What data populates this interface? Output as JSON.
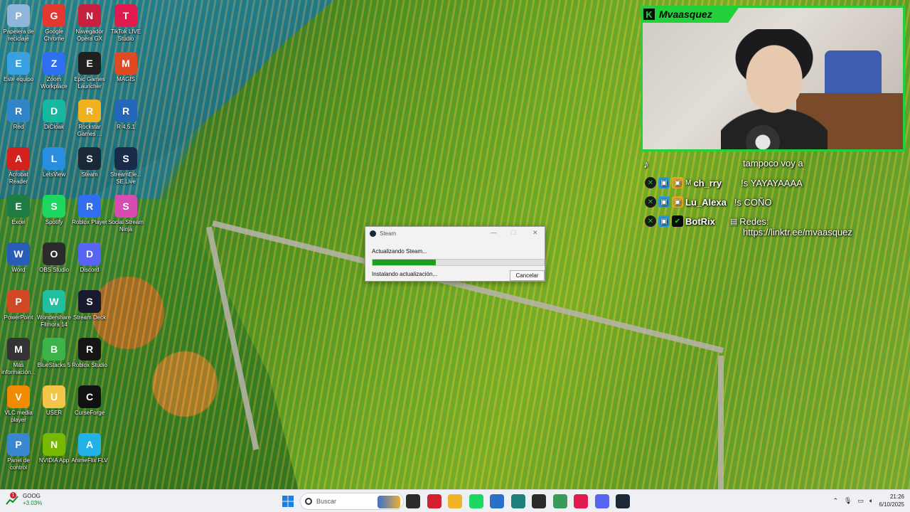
{
  "desktop": {
    "icons": [
      {
        "label": "Papelera de reciclaje",
        "icon": "recycle-bin-icon",
        "color": "#8fb6d9"
      },
      {
        "label": "Google Chrome",
        "icon": "chrome-icon",
        "color": "#e3382f"
      },
      {
        "label": "Navegador Opera GX",
        "icon": "opera-gx-icon",
        "color": "#c8203f"
      },
      {
        "label": "TikTok LIVE Studio",
        "icon": "tiktok-live-icon",
        "color": "#e01a4f"
      },
      {
        "label": "Este equipo",
        "icon": "computer-icon",
        "color": "#3aa0e0"
      },
      {
        "label": "Zoom Workplace",
        "icon": "zoom-icon",
        "color": "#2d6ff0"
      },
      {
        "label": "Epic Games Launcher",
        "icon": "epic-games-icon",
        "color": "#202020"
      },
      {
        "label": "MAGIS",
        "icon": "magis-icon",
        "color": "#e04a22"
      },
      {
        "label": "Red",
        "icon": "network-icon",
        "color": "#2f85c8"
      },
      {
        "label": "DiCloak",
        "icon": "dicloak-icon",
        "color": "#17b8a0"
      },
      {
        "label": "Rockstar Games ...",
        "icon": "rockstar-icon",
        "color": "#f0b020"
      },
      {
        "label": "R 4.5.1",
        "icon": "r-icon",
        "color": "#2466b8"
      },
      {
        "label": "Acrobat Reader",
        "icon": "acrobat-icon",
        "color": "#d3221e"
      },
      {
        "label": "LetsView",
        "icon": "letsview-icon",
        "color": "#2a8ee0"
      },
      {
        "label": "Steam",
        "icon": "steam-icon",
        "color": "#1b2838"
      },
      {
        "label": "StreamEle... SE.Live",
        "icon": "streamelements-icon",
        "color": "#1a2b4a"
      },
      {
        "label": "Excel",
        "icon": "excel-icon",
        "color": "#1d7b44"
      },
      {
        "label": "Spotify",
        "icon": "spotify-icon",
        "color": "#1ed760"
      },
      {
        "label": "Roblox Player",
        "icon": "roblox-player-icon",
        "color": "#2f6ff0"
      },
      {
        "label": "Social Stream Ninja",
        "icon": "social-stream-icon",
        "color": "#d84bb0"
      },
      {
        "label": "Word",
        "icon": "word-icon",
        "color": "#2a5bb5"
      },
      {
        "label": "OBS Studio",
        "icon": "obs-icon",
        "color": "#2b2b2b"
      },
      {
        "label": "Discord",
        "icon": "discord-icon",
        "color": "#5865f2"
      },
      {
        "label": "PowerPoint",
        "icon": "powerpoint-icon",
        "color": "#d24726"
      },
      {
        "label": "Wondershare Filmora 14",
        "icon": "filmora-icon",
        "color": "#1fbf9f"
      },
      {
        "label": "Stream Deck",
        "icon": "stream-deck-icon",
        "color": "#1a1a2e"
      },
      {
        "label": "Más información...",
        "icon": "info-icon",
        "color": "#333333"
      },
      {
        "label": "BlueStacks 5",
        "icon": "bluestacks-icon",
        "color": "#3cb44a"
      },
      {
        "label": "Roblox Studio",
        "icon": "roblox-studio-icon",
        "color": "#151515"
      },
      {
        "label": "VLC media player",
        "icon": "vlc-icon",
        "color": "#f08a00"
      },
      {
        "label": "USER",
        "icon": "folder-icon",
        "color": "#f3c548"
      },
      {
        "label": "CurseForge",
        "icon": "curseforge-icon",
        "color": "#111111"
      },
      {
        "label": "Panel de control",
        "icon": "control-panel-icon",
        "color": "#3a86d0"
      },
      {
        "label": "NVIDIA App",
        "icon": "nvidia-icon",
        "color": "#76b900"
      },
      {
        "label": "AnimeFlix FLV",
        "icon": "animeflix-icon",
        "color": "#22b2e5"
      }
    ]
  },
  "overlay": {
    "streamer_name": "Mvaasquez",
    "accent": "#22d13a",
    "chat": {
      "top_text": "tampoco voy a",
      "messages": [
        {
          "user": "ch_rry",
          "text": "!s YAYAYAAAA"
        },
        {
          "user": "Lu_Alexa",
          "text": "!s COÑO"
        },
        {
          "user": "BotRix",
          "text": "Redes:"
        }
      ],
      "botrix_link": "https://linktr.ee/mvaasquez"
    }
  },
  "steam_dialog": {
    "title": "Steam",
    "status": "Actualizando Steam...",
    "progress_fraction": 0.37,
    "substatus": "Instalando actualización...",
    "cancel_label": "Cancelar",
    "progress_color": "#1ea01e"
  },
  "taskbar": {
    "stock_ticker": "GOOG",
    "stock_change": "+3.03%",
    "notification_count": "1",
    "search_placeholder": "Buscar",
    "pinned": [
      {
        "icon": "file-explorer-small-icon",
        "color": "#2b2b2b"
      },
      {
        "icon": "opera-icon",
        "color": "#d3202f"
      },
      {
        "icon": "folder-icon",
        "color": "#f0b429"
      },
      {
        "icon": "spotify-icon",
        "color": "#1ed760"
      },
      {
        "icon": "store-icon",
        "color": "#2a6fc8"
      },
      {
        "icon": "filmora-icon",
        "color": "#1f7f7a"
      },
      {
        "icon": "obs-icon",
        "color": "#2b2b2b"
      },
      {
        "icon": "social-stream-icon",
        "color": "#3a9a5a"
      },
      {
        "icon": "tiktok-live-icon",
        "color": "#e01a4f"
      },
      {
        "icon": "discord-icon",
        "color": "#5865f2"
      },
      {
        "icon": "steam-icon",
        "color": "#1b2838"
      }
    ],
    "time": "21:26",
    "date": "6/10/2025"
  }
}
